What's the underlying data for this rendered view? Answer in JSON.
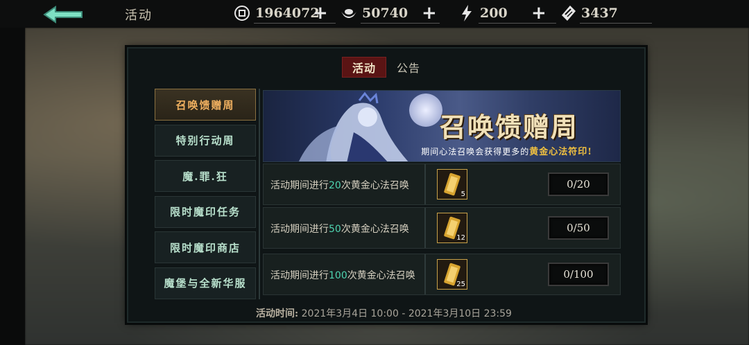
{
  "header": {
    "title": "活动",
    "resources": [
      {
        "icon": "coin-icon",
        "value": "1964072"
      },
      {
        "icon": "ingot-icon",
        "value": "50740"
      },
      {
        "icon": "lightning-icon",
        "value": "200"
      },
      {
        "icon": "ticket-icon",
        "value": "3437"
      }
    ],
    "plus": "+"
  },
  "tabs": [
    {
      "label": "活动",
      "active": true
    },
    {
      "label": "公告",
      "active": false
    }
  ],
  "sidebar": {
    "items": [
      {
        "label": "召唤馈赠周",
        "active": true
      },
      {
        "label": "特别行动周",
        "active": false
      },
      {
        "label": "魔.罪.狂",
        "active": false
      },
      {
        "label": "限时魔印任务",
        "active": false
      },
      {
        "label": "限时魔印商店",
        "active": false
      },
      {
        "label": "魔堡与全新华服",
        "active": false
      }
    ]
  },
  "banner": {
    "title": "召唤馈赠周",
    "subtitle_prefix": "期间心法召唤会获得更多的",
    "subtitle_highlight": "黄金心法符印!"
  },
  "tasks": [
    {
      "prefix": "活动期间进行",
      "number": "20",
      "suffix": "次黄金心法召唤",
      "reward_count": "5",
      "progress": "0/20"
    },
    {
      "prefix": "活动期间进行",
      "number": "50",
      "suffix": "次黄金心法召唤",
      "reward_count": "12",
      "progress": "0/50"
    },
    {
      "prefix": "活动期间进行",
      "number": "100",
      "suffix": "次黄金心法召唤",
      "reward_count": "25",
      "progress": "0/100"
    }
  ],
  "footer": {
    "label": "活动时间:",
    "time": "2021年3月4日 10:00 - 2021年3月10日 23:59"
  },
  "colors": {
    "accent_active_tab": "#5a1414",
    "highlight_number": "#4fd4b0",
    "sidebar_active_text": "#f0b060",
    "reward_border": "#c8a24a"
  }
}
